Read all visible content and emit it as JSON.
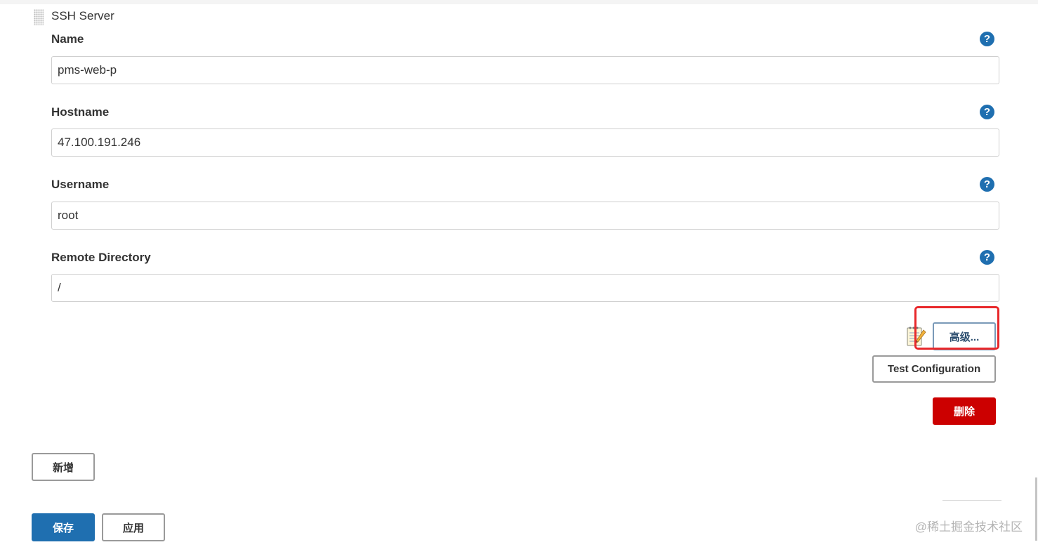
{
  "section": {
    "title": "SSH Server"
  },
  "fields": {
    "name": {
      "label": "Name",
      "value": "pms-web-p"
    },
    "hostname": {
      "label": "Hostname",
      "value": "47.100.191.246"
    },
    "username": {
      "label": "Username",
      "value": "root"
    },
    "remote_directory": {
      "label": "Remote Directory",
      "value": "/"
    }
  },
  "help_icon_glyph": "?",
  "buttons": {
    "advanced": "高级...",
    "test_configuration": "Test Configuration",
    "delete": "删除",
    "add": "新增",
    "save": "保存",
    "apply": "应用"
  },
  "watermark": "@稀土掘金技术社区",
  "icons": {
    "help": "question-circle-icon",
    "notepad": "notepad-icon",
    "drag": "drag-handle-icon"
  },
  "colors": {
    "primary": "#1f6fb0",
    "danger": "#cc0000",
    "highlight": "#e8282b"
  }
}
